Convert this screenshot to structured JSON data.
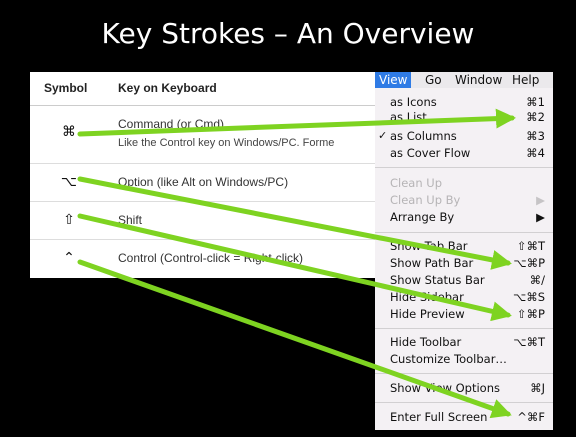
{
  "title": "Key Strokes – An Overview",
  "table": {
    "headers": {
      "symbol": "Symbol",
      "key": "Key on Keyboard"
    },
    "rows": [
      {
        "symbol": "⌘",
        "key": "Command  (or Cmd)",
        "note": "Like the Control key on Windows/PC. Forme"
      },
      {
        "symbol": "⌥",
        "key": "Option  (like Alt on Windows/PC)"
      },
      {
        "symbol": "⇧",
        "key": "Shift"
      },
      {
        "symbol": "⌃",
        "key": "Control  (Control-click = Right-click)"
      }
    ]
  },
  "menu": {
    "bar": [
      "View",
      "Go",
      "Window",
      "Help"
    ],
    "items": [
      {
        "label": "as Icons",
        "shortcut": "⌘1"
      },
      {
        "label": "as List",
        "shortcut": "⌘2"
      },
      {
        "label": "as Columns",
        "shortcut": "⌘3",
        "checked": "✓"
      },
      {
        "label": "as Cover Flow",
        "shortcut": "⌘4"
      },
      {
        "label": "Clean Up",
        "disabled": true
      },
      {
        "label": "Clean Up By",
        "shortcut": "▶",
        "disabled": true
      },
      {
        "label": "Arrange By",
        "shortcut": "▶"
      },
      {
        "label": "Show Tab Bar",
        "shortcut": "⇧⌘T"
      },
      {
        "label": "Show Path Bar",
        "shortcut": "⌥⌘P"
      },
      {
        "label": "Show Status Bar",
        "shortcut": "⌘/"
      },
      {
        "label": "Hide Sidebar",
        "shortcut": "⌥⌘S"
      },
      {
        "label": "Hide Preview",
        "shortcut": "⇧⌘P"
      },
      {
        "label": "Hide Toolbar",
        "shortcut": "⌥⌘T"
      },
      {
        "label": "Customize Toolbar…"
      },
      {
        "label": "Show View Options",
        "shortcut": "⌘J"
      },
      {
        "label": "Enter Full Screen",
        "shortcut": "^⌘F"
      }
    ]
  },
  "colors": {
    "arrow": "#7ed321",
    "menu_highlight": "#2f7be5"
  }
}
